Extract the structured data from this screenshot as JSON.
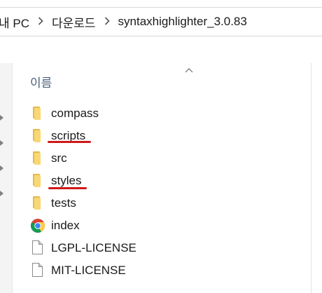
{
  "address_bar": {
    "crumbs": [
      "내 PC",
      "다운로드",
      "syntaxhighlighter_3.0.83"
    ],
    "separator_icon": "chevron-right-icon"
  },
  "list_header": {
    "name_column": "이름",
    "sort_indicator_icon": "chevron-up-icon"
  },
  "items": [
    {
      "name": "compass",
      "type": "folder",
      "icon": "folder-icon",
      "underlined": false
    },
    {
      "name": "scripts",
      "type": "folder",
      "icon": "folder-icon",
      "underlined": true
    },
    {
      "name": "src",
      "type": "folder",
      "icon": "folder-icon",
      "underlined": false
    },
    {
      "name": "styles",
      "type": "folder",
      "icon": "folder-icon",
      "underlined": true
    },
    {
      "name": "tests",
      "type": "folder",
      "icon": "folder-icon",
      "underlined": false
    },
    {
      "name": "index",
      "type": "html",
      "icon": "chrome-icon",
      "underlined": false
    },
    {
      "name": "LGPL-LICENSE",
      "type": "file",
      "icon": "file-icon",
      "underlined": false
    },
    {
      "name": "MIT-LICENSE",
      "type": "file",
      "icon": "file-icon",
      "underlined": false
    }
  ],
  "colors": {
    "folder_front": "#f8d775",
    "folder_back": "#e8b84a",
    "header_text": "#4c607a",
    "annotation_underline": "#d01818"
  }
}
